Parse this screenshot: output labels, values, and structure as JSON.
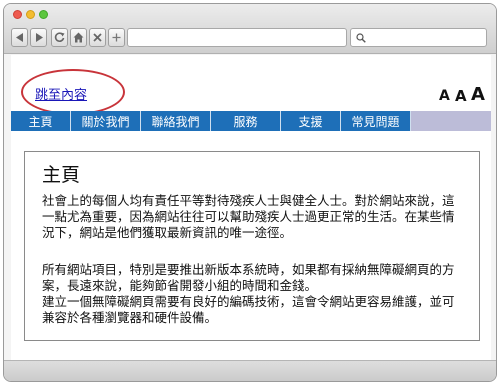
{
  "page": {
    "skip_link": "跳至內容",
    "font_sizes": [
      "A",
      "A",
      "A"
    ],
    "menu": [
      "主頁",
      "關於我們",
      "聯絡我們",
      "服務",
      "支援",
      "常見問題"
    ],
    "heading": "主頁",
    "paragraph1": "社會上的每個人均有責任平等對待殘疾人士與健全人士。對於網站來說，這一點尤為重要，因為網站往往可以幫助殘疾人士過更正常的生活。在某些情況下，網站是他們獲取最新資訊的唯一途徑。",
    "paragraph2": "所有網站項目，特別是要推出新版本系統時，如果都有採納無障礙網頁的方案，長遠來說，能夠節省開發小組的時間和金錢。",
    "paragraph3": "建立一個無障礙網頁需要有良好的編碼技術，這會令網站更容易維護，並可兼容於各種瀏覽器和硬件設備。"
  },
  "toolbar": {
    "icons": [
      "back-icon",
      "forward-icon",
      "reload-icon",
      "home-icon",
      "stop-icon",
      "new-tab-icon",
      "search-icon"
    ]
  },
  "colors": {
    "menu_blue": "#1e6fb8",
    "menu_strip": "#bcbcd8",
    "highlight_ellipse": "#c8343a",
    "link": "#1a17b8"
  }
}
